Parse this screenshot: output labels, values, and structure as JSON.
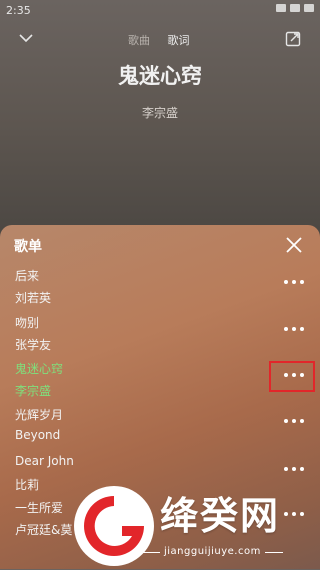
{
  "status_bar": {
    "time": "2:35"
  },
  "header": {
    "tabs": [
      {
        "label": "歌曲",
        "active": false
      },
      {
        "label": "歌词",
        "active": true
      }
    ],
    "collapse_icon": "chevron-down-icon",
    "share_icon": "share-icon"
  },
  "now_playing": {
    "title": "鬼迷心窍",
    "artist": "李宗盛"
  },
  "playlist": {
    "title": "歌单",
    "close_icon": "close-icon",
    "items": [
      {
        "name": "后来",
        "artist": "刘若英",
        "playing": false
      },
      {
        "name": "吻别",
        "artist": "张学友",
        "playing": false
      },
      {
        "name": "鬼迷心窍",
        "artist": "李宗盛",
        "playing": true
      },
      {
        "name": "光辉岁月",
        "artist": "Beyond",
        "playing": false
      },
      {
        "name": "Dear John",
        "artist": "比莉",
        "playing": false
      },
      {
        "name": "一生所爱",
        "artist": "卢冠廷&莫",
        "playing": false
      }
    ]
  },
  "colors": {
    "playing": "#7fe07c",
    "highlight": "#e2262a"
  },
  "watermark": {
    "name": "绛癸网",
    "url": "jiangguijiuye.com"
  }
}
